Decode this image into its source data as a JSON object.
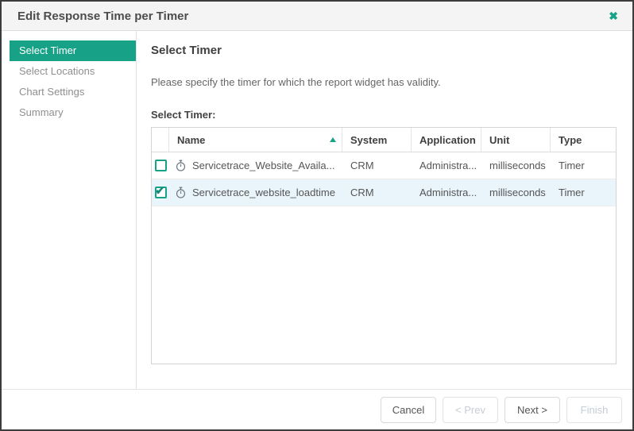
{
  "dialog": {
    "title": "Edit Response Time per Timer",
    "accent_color": "#17a287"
  },
  "sidebar": {
    "items": [
      {
        "label": "Select Timer",
        "active": true
      },
      {
        "label": "Select Locations",
        "active": false
      },
      {
        "label": "Chart Settings",
        "active": false
      },
      {
        "label": "Summary",
        "active": false
      }
    ]
  },
  "main": {
    "heading": "Select Timer",
    "description": "Please specify the timer for which the report widget has validity.",
    "table_label": "Select Timer:",
    "table": {
      "columns": [
        "Name",
        "System",
        "Application",
        "Unit",
        "Type"
      ],
      "sort": {
        "column": "Name",
        "direction": "asc"
      },
      "rows": [
        {
          "checked": false,
          "highlighted": false,
          "name": "Servicetrace_Website_Availa...",
          "system": "CRM",
          "application": "Administra...",
          "unit": "milliseconds",
          "type": "Timer"
        },
        {
          "checked": true,
          "highlighted": true,
          "name": "Servicetrace_website_loadtime",
          "system": "CRM",
          "application": "Administra...",
          "unit": "milliseconds",
          "type": "Timer"
        }
      ]
    }
  },
  "footer": {
    "buttons": [
      {
        "label": "Cancel",
        "enabled": true
      },
      {
        "label": "< Prev",
        "enabled": false
      },
      {
        "label": "Next >",
        "enabled": true
      },
      {
        "label": "Finish",
        "enabled": false
      }
    ]
  }
}
